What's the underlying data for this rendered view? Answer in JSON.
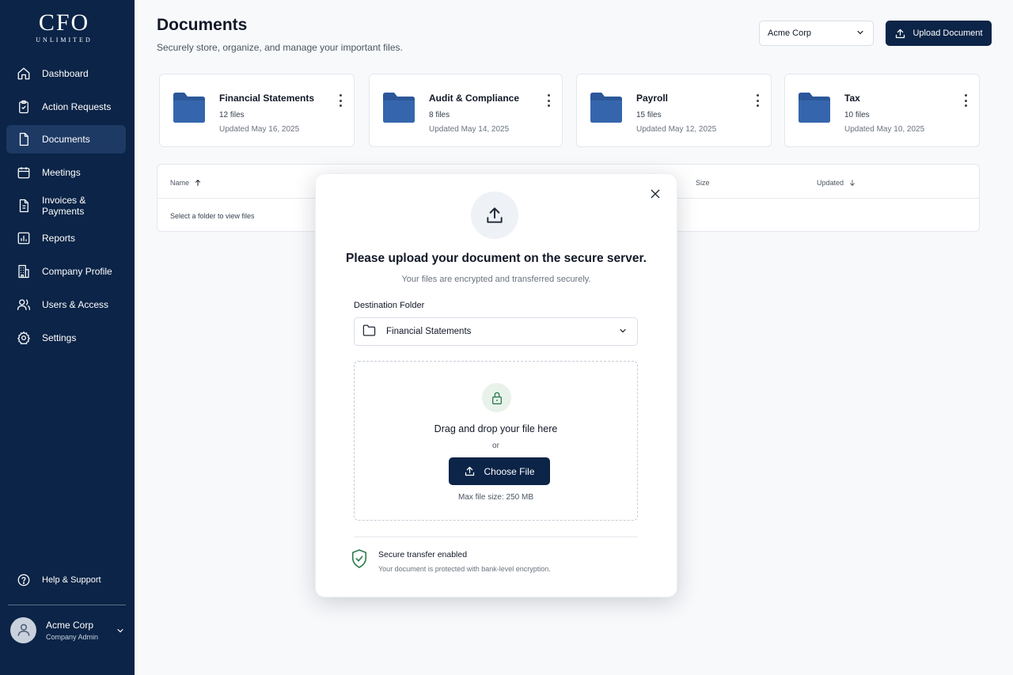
{
  "brand": {
    "logo_main": "CFO",
    "logo_sub": "UNLIMITED"
  },
  "sidebar": {
    "items": [
      {
        "label": "Dashboard",
        "icon": "home-icon"
      },
      {
        "label": "Action Requests",
        "icon": "clipboard-icon"
      },
      {
        "label": "Documents",
        "icon": "file-icon",
        "active": true
      },
      {
        "label": "Meetings",
        "icon": "calendar-icon"
      },
      {
        "label": "Invoices & Payments",
        "icon": "invoice-icon"
      },
      {
        "label": "Reports",
        "icon": "bar-chart-icon"
      },
      {
        "label": "Company Profile",
        "icon": "building-icon"
      },
      {
        "label": "Users & Access",
        "icon": "users-icon"
      },
      {
        "label": "Settings",
        "icon": "gear-icon"
      }
    ],
    "help_label": "Help & Support",
    "user": {
      "name": "Acme Corp",
      "role": "Company Admin"
    }
  },
  "header": {
    "title": "Documents",
    "subtitle": "Securely store, organize, and manage your important files.",
    "company_select": "Acme Corp",
    "upload_label": "Upload Document"
  },
  "folders": [
    {
      "name": "Financial Statements",
      "count": "12 files",
      "updated": "Updated May 16, 2025"
    },
    {
      "name": "Audit & Compliance",
      "count": "8 files",
      "updated": "Updated May 14, 2025"
    },
    {
      "name": "Payroll",
      "count": "15 files",
      "updated": "Updated May 12, 2025"
    },
    {
      "name": "Tax",
      "count": "10 files",
      "updated": "Updated May 10, 2025"
    }
  ],
  "table": {
    "columns": {
      "name": "Name",
      "size": "Size",
      "updated": "Updated"
    },
    "empty_text": "Select a folder to view files"
  },
  "modal": {
    "title": "Please upload your document on the secure server.",
    "subtitle": "Your files are encrypted and transferred securely.",
    "destination_label": "Destination Folder",
    "destination_value": "Financial Statements",
    "drag_text": "Drag and drop your file here",
    "or_text": "or",
    "choose_label": "Choose File",
    "max_size": "Max file size: 250 MB",
    "secure_title": "Secure transfer enabled",
    "secure_sub": "Your document is protected with bank-level encryption."
  },
  "colors": {
    "sidebar_bg": "#0b2447",
    "folder_blue": "#2b579a",
    "secure_green": "#2e7d4f"
  }
}
